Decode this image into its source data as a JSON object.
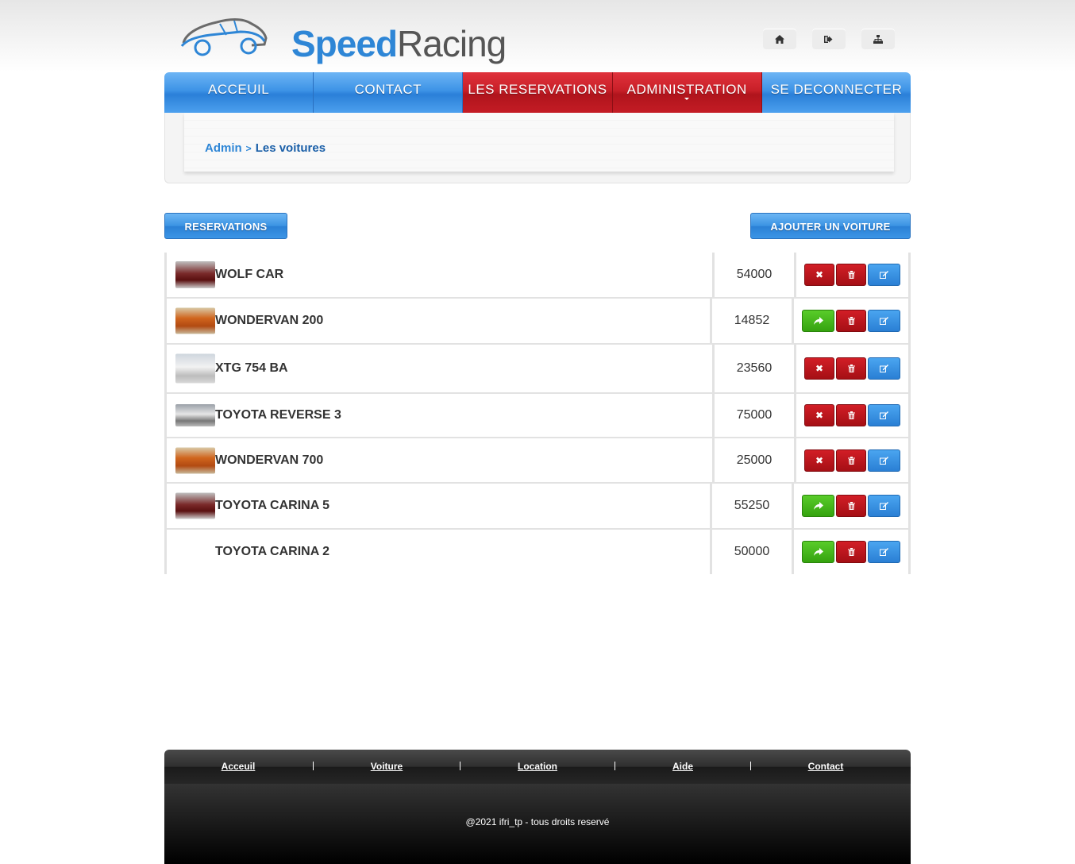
{
  "header": {
    "logo_part1": "Speed",
    "logo_part2": "Racing",
    "icons": [
      "home-icon",
      "sign-out-icon",
      "sitemap-icon"
    ]
  },
  "nav": {
    "items": [
      {
        "label": "ACCEUIL",
        "active": false
      },
      {
        "label": "CONTACT",
        "active": false
      },
      {
        "label": "LES RESERVATIONS",
        "active": true
      },
      {
        "label": "ADMINISTRATION",
        "active": true
      },
      {
        "label": "SE DECONNECTER",
        "active": false
      }
    ]
  },
  "breadcrumb": {
    "root": "Admin",
    "separator": ">",
    "current": "Les voitures"
  },
  "actions": {
    "reservations_label": "RESERVATIONS",
    "add_car_label": "AJOUTER UN VOITURE"
  },
  "cars": [
    {
      "name": "WOLF CAR",
      "price": "54000",
      "status_action": "cancel",
      "thumb": "red-car"
    },
    {
      "name": "WONDERVAN 200",
      "price": "14852",
      "status_action": "reserve",
      "thumb": "orange-van"
    },
    {
      "name": "XTG 754 BA",
      "price": "23560",
      "status_action": "cancel",
      "thumb": "white-car"
    },
    {
      "name": "TOYOTA REVERSE 3",
      "price": "75000",
      "status_action": "cancel",
      "thumb": "grey-car"
    },
    {
      "name": "WONDERVAN 700",
      "price": "25000",
      "status_action": "cancel",
      "thumb": "orange-van"
    },
    {
      "name": "TOYOTA CARINA 5",
      "price": "55250",
      "status_action": "reserve",
      "thumb": "red-car"
    },
    {
      "name": "TOYOTA CARINA 2",
      "price": "50000",
      "status_action": "reserve",
      "thumb": ""
    }
  ],
  "footer": {
    "links": [
      "Acceuil",
      "Voiture",
      "Location",
      "Aide",
      "Contact"
    ],
    "copyright": "@2021 ifri_tp - tous droits reservé"
  },
  "colors": {
    "accent_blue": "#2e86d6",
    "active_red": "#c81f28",
    "success_green": "#35a30f"
  }
}
